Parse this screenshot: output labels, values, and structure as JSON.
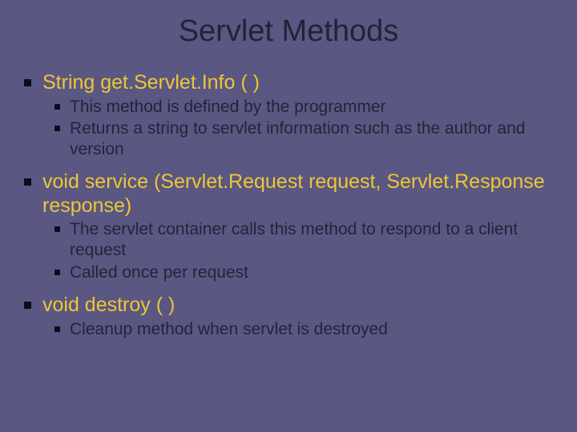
{
  "title": "Servlet Methods",
  "items": [
    {
      "label": "String get.Servlet.Info ( )",
      "subs": [
        "This method is defined by the programmer",
        "Returns a string to servlet information such as the author and version"
      ]
    },
    {
      "label": "void service (Servlet.Request request, Servlet.Response response)",
      "subs": [
        "The servlet container calls this method to respond to a client request",
        "Called once per request"
      ]
    },
    {
      "label": "void destroy ( )",
      "subs": [
        "Cleanup method when servlet is destroyed"
      ]
    }
  ]
}
